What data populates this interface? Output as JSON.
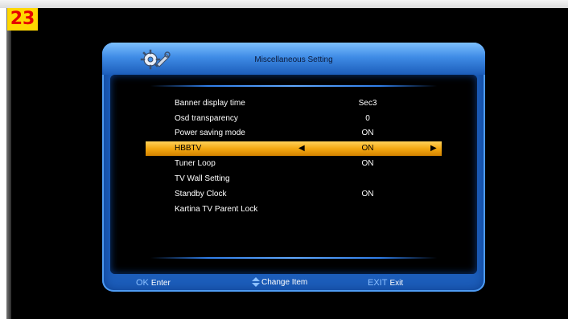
{
  "badge": "23",
  "menu": {
    "title": "Miscellaneous Setting",
    "items": [
      {
        "label": "Banner display time",
        "value": "Sec3"
      },
      {
        "label": "Osd transparency",
        "value": "0"
      },
      {
        "label": "Power saving mode",
        "value": "ON"
      },
      {
        "label": "HBBTV",
        "value": "ON"
      },
      {
        "label": "Tuner Loop",
        "value": "ON"
      },
      {
        "label": "TV Wall Setting",
        "value": ""
      },
      {
        "label": "Standby Clock",
        "value": "ON"
      },
      {
        "label": "Kartina TV Parent Lock",
        "value": ""
      }
    ],
    "selected_index": 3
  },
  "footer": {
    "ok_key": "OK",
    "ok_label": "Enter",
    "change_label": "Change Item",
    "exit_key": "EXIT",
    "exit_label": "Exit"
  },
  "icons": {
    "header": "gear-wrench-icon",
    "left_arrow": "triangle-left-icon",
    "right_arrow": "triangle-right-icon",
    "updown": "up-down-arrows-icon"
  },
  "colors": {
    "frame": "#1c5dba",
    "highlight": "#f4a812",
    "badge_bg": "#ffd700",
    "badge_fg": "#e60000"
  }
}
